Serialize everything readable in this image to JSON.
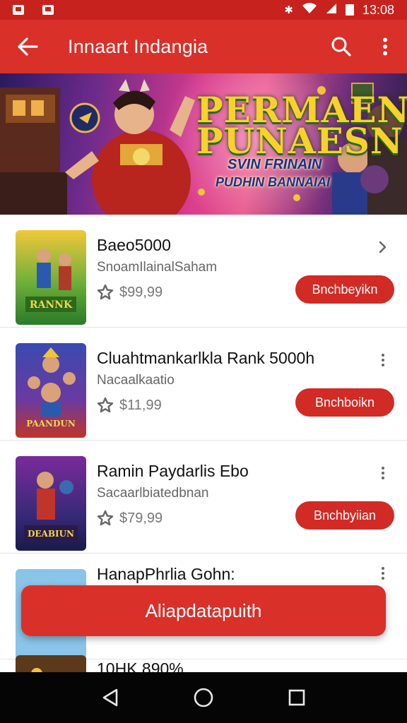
{
  "status_bar": {
    "time": "13:08"
  },
  "app_bar": {
    "title": "Innaart Indangia"
  },
  "banner": {
    "headline": "PERMAEN PUNAESN",
    "line1": "SVIN FRINAIN",
    "line2": "PUDHIN BANNAIAI"
  },
  "items": [
    {
      "title": "Baeo5000",
      "subtitle": "SnoamIlainalSaham",
      "price": "$99,99",
      "button": "Bnchbeyikn",
      "menu": "chevron-right-icon"
    },
    {
      "title": "Cluahtmankarlkla Rank 5000h",
      "subtitle": "Nacaalkaatio",
      "price": "$11,99",
      "button": "Bnchboikn",
      "menu": "more-vert-icon"
    },
    {
      "title": "Ramin Paydarlis Ebo",
      "subtitle": "Sacaarlbiatedbnan",
      "price": "$79,99",
      "button": "Bnchbyiian",
      "menu": "more-vert-icon"
    },
    {
      "title": "HanapPhrlia Gohn:",
      "subtitle": "",
      "price": "",
      "button": "",
      "menu": "more-vert-icon"
    },
    {
      "title": "10HK 890%",
      "subtitle": "",
      "price": "",
      "button": "",
      "menu": ""
    }
  ],
  "primary_action": {
    "label": "Aliapdatapuith"
  },
  "colors": {
    "primary": "#d9302a",
    "status": "#c7221d",
    "button": "#d22a25"
  }
}
